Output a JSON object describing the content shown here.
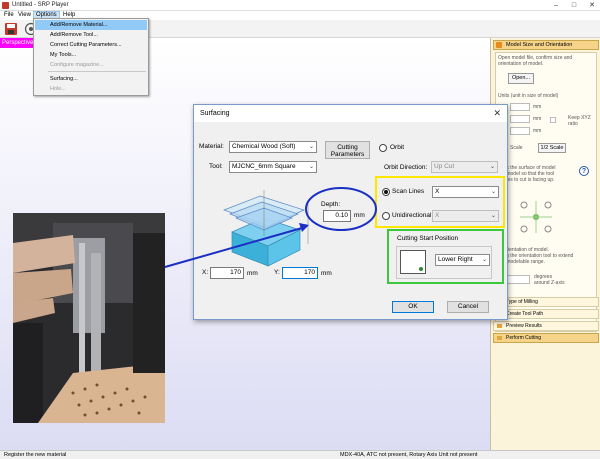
{
  "window": {
    "title": "Untitled - SRP Player"
  },
  "menubar": {
    "items": [
      "File",
      "View",
      "Options",
      "Help"
    ]
  },
  "options_menu": {
    "items": [
      "Add/Remove Material...",
      "Add/Remove Tool...",
      "Correct Cutting Parameters...",
      "My Tools...",
      "Configure magazine...",
      "Surfacing...",
      "Hole..."
    ]
  },
  "viewport": {
    "tab_label": "Perspective"
  },
  "dialog": {
    "title": "Surfacing",
    "material_label": "Material:",
    "material_value": "Chemical Wood (Soft)",
    "cutting_params_button": [
      "Cutting",
      "Parameters"
    ],
    "orbit_label": "Orbit",
    "tool_label": "Tool:",
    "tool_value": "MJCNC_6mm Square",
    "orbit_direction_label": "Orbit Direction:",
    "orbit_direction_value": "Up Cut",
    "depth_label": "Depth:",
    "depth_value": "0.10",
    "depth_unit": "mm",
    "scan_lines_label": "Scan Lines",
    "scan_lines_value": "X",
    "unidirectional_label": "Unidirectional",
    "unidirectional_value": "X",
    "cutting_start_label": "Cutting Start Position",
    "cutting_start_value": "Lower Right",
    "x_label": "X:",
    "x_value": "170",
    "x_unit": "mm",
    "y_label": "Y:",
    "y_value": "170",
    "y_unit": "mm",
    "ok_label": "OK",
    "cancel_label": "Cancel"
  },
  "right_panel": {
    "header": "Model Size and Orientation",
    "intro_lines": [
      "Open model file, confirm size and",
      "orientation of model."
    ],
    "open_button": "Open...",
    "size_caption": "Units (unit in size of model)",
    "unit_mm": "mm",
    "keep_xyz_lines": [
      "Keep XYZ",
      "ratio"
    ],
    "scale_label": "Scale",
    "scale_button": "1/2 Scale",
    "surface_lines": [
      "Click the surface of model",
      "the model so that the tool",
      "comes to cut is facing up."
    ],
    "orientation_lines": [
      "ta orientation of model.",
      "Drag the orientation tool to extend",
      "the modelable range."
    ],
    "degrees_lines": [
      "degrees",
      "around Z-axis"
    ],
    "sections": [
      "Type of Milling",
      "Create Tool Path",
      "Preview Results",
      "Perform Cutting"
    ]
  },
  "status": {
    "left": "Register the new material",
    "right": "MDX-40A, ATC not present, Rotary Axis Unit not present"
  },
  "colors": {
    "yellow_highlight": "#ffe600",
    "green_highlight": "#3cc83c",
    "callout_blue": "#1a2fc4",
    "menu_highlight": "#91c9f7"
  },
  "icons": [
    "save-icon",
    "open-icon",
    "close-icon",
    "minimize-icon",
    "maximize-icon",
    "help-icon"
  ]
}
